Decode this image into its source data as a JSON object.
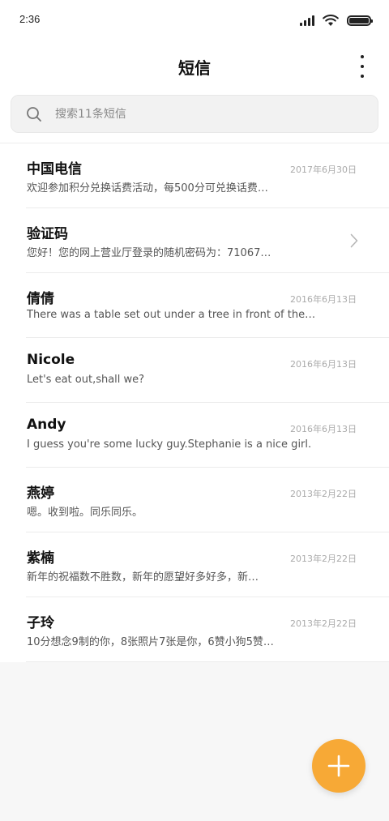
{
  "status_bar": {
    "time": "2:36"
  },
  "header": {
    "title": "短信"
  },
  "search": {
    "placeholder": "搜索11条短信"
  },
  "messages": [
    {
      "name": "中国电信",
      "date": "2017年6月30日",
      "preview": "欢迎参加积分兑换话费活动，每500分可兑换话费…"
    },
    {
      "name": "验证码",
      "date": "",
      "preview": "您好！您的网上营业厅登录的随机密码为：71067…"
    },
    {
      "name": "倩倩",
      "date": "2016年6月13日",
      "preview": "There was a table set out under a tree in front of the hous"
    },
    {
      "name": "Nicole",
      "date": "2016年6月13日",
      "preview": "Let's eat out,shall we?"
    },
    {
      "name": "Andy",
      "date": "2016年6月13日",
      "preview": "I guess you're some lucky guy.Stephanie is a nice girl."
    },
    {
      "name": "燕婷",
      "date": "2013年2月22日",
      "preview": "嗯。收到啦。同乐同乐。"
    },
    {
      "name": "紫楠",
      "date": "2013年2月22日",
      "preview": "新年的祝福数不胜数，新年的愿望好多好多，新…"
    },
    {
      "name": "子玲",
      "date": "2013年2月22日",
      "preview": "10分想念9制的你，8张照片7张是你，6赞小狗5赞…"
    }
  ],
  "icons": {
    "signal": "signal-icon",
    "wifi": "wifi-icon",
    "battery": "battery-icon",
    "more": "more-vertical-icon",
    "search": "search-icon",
    "chevron": "chevron-right-icon",
    "fab": "plus-icon"
  },
  "colors": {
    "accent": "#f7a936",
    "background": "#f7f7f7"
  }
}
